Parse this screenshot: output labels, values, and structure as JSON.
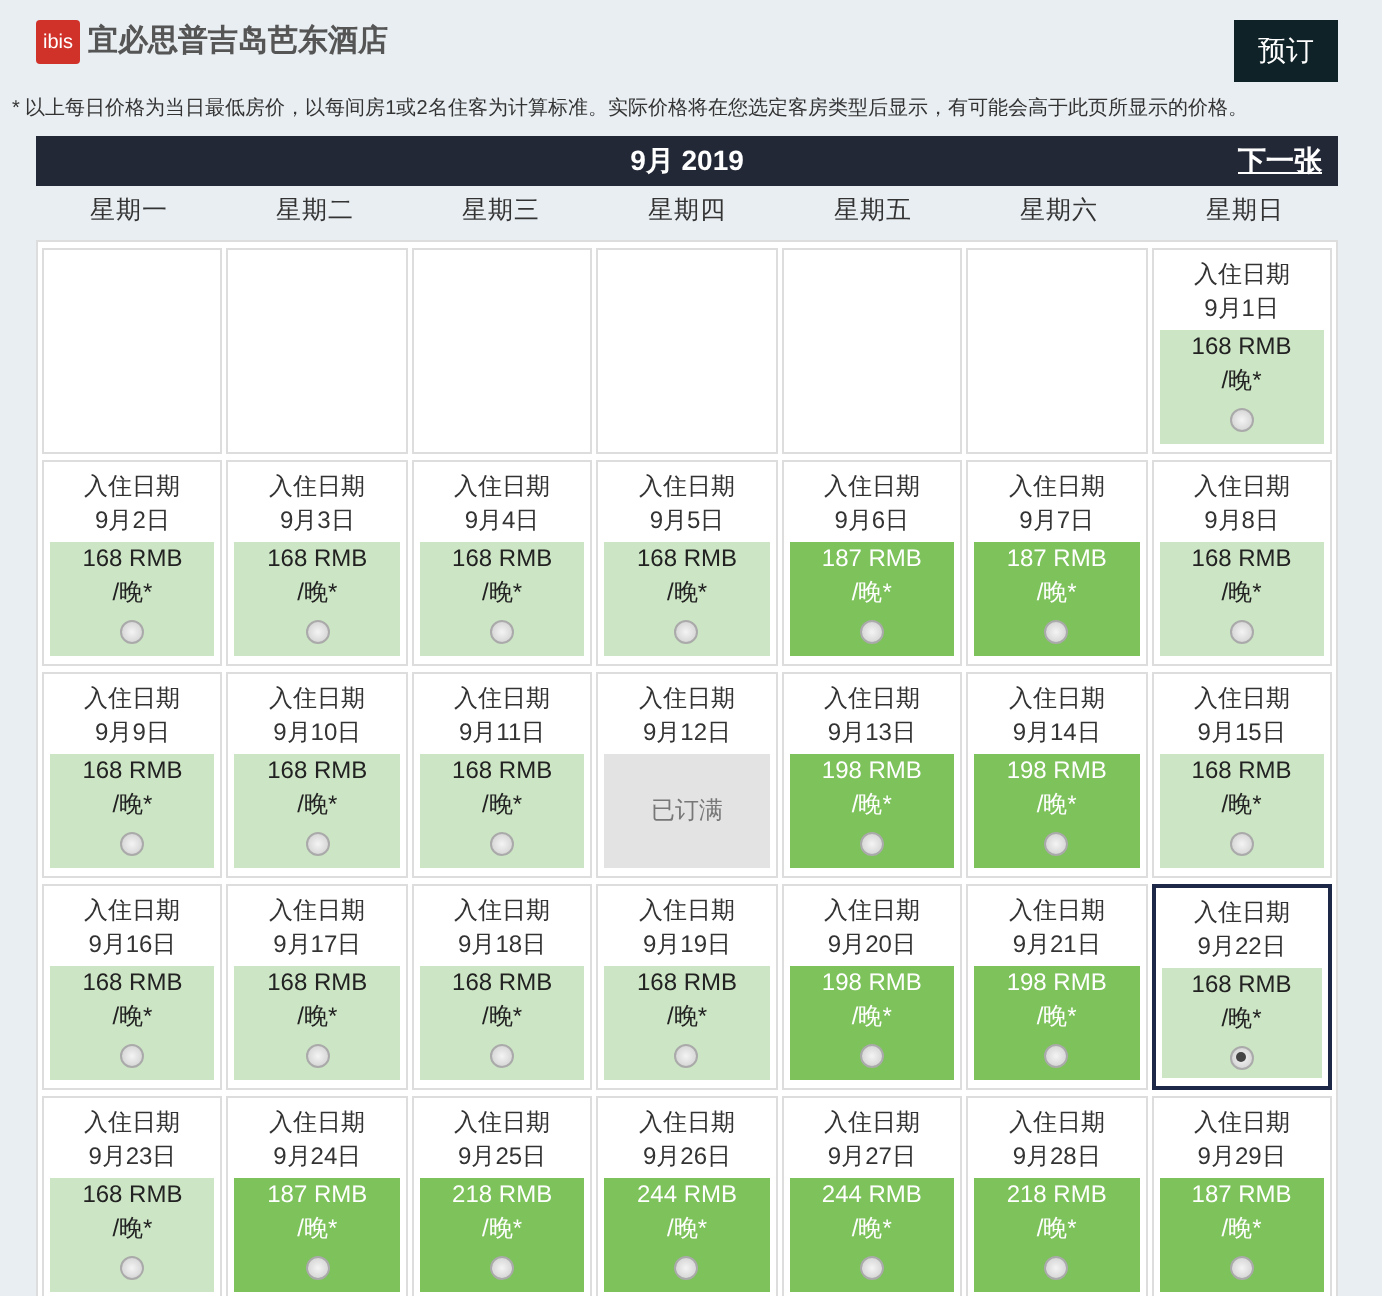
{
  "hotel": {
    "logo": "ibis",
    "name": "宜必思普吉岛芭东酒店"
  },
  "book_button": "预订",
  "note": "* 以上每日价格为当日最低房价，以每间房1或2名住客为计算标准。实际价格将在您选定客房类型后显示，有可能会高于此页所显示的价格。",
  "calendar": {
    "month": "9月 2019",
    "next": "下一张",
    "weekdays": [
      "星期一",
      "星期二",
      "星期三",
      "星期四",
      "星期五",
      "星期六",
      "星期日"
    ],
    "weeks": [
      [
        {
          "kind": "empty"
        },
        {
          "kind": "empty"
        },
        {
          "kind": "empty"
        },
        {
          "kind": "empty"
        },
        {
          "kind": "empty"
        },
        {
          "kind": "empty"
        },
        {
          "kind": "open",
          "label": "入住日期",
          "date": "9月1日",
          "price": "168 RMB",
          "per": "/晚*",
          "color": "#cce5c4",
          "selected": false
        }
      ],
      [
        {
          "kind": "open",
          "label": "入住日期",
          "date": "9月2日",
          "price": "168 RMB",
          "per": "/晚*",
          "color": "#cce5c4",
          "selected": false
        },
        {
          "kind": "open",
          "label": "入住日期",
          "date": "9月3日",
          "price": "168 RMB",
          "per": "/晚*",
          "color": "#cce5c4",
          "selected": false
        },
        {
          "kind": "open",
          "label": "入住日期",
          "date": "9月4日",
          "price": "168 RMB",
          "per": "/晚*",
          "color": "#cce5c4",
          "selected": false
        },
        {
          "kind": "open",
          "label": "入住日期",
          "date": "9月5日",
          "price": "168 RMB",
          "per": "/晚*",
          "color": "#cce5c4",
          "selected": false
        },
        {
          "kind": "open",
          "label": "入住日期",
          "date": "9月6日",
          "price": "187 RMB",
          "per": "/晚*",
          "color": "#7dc25b",
          "selected": false
        },
        {
          "kind": "open",
          "label": "入住日期",
          "date": "9月7日",
          "price": "187 RMB",
          "per": "/晚*",
          "color": "#7dc25b",
          "selected": false
        },
        {
          "kind": "open",
          "label": "入住日期",
          "date": "9月8日",
          "price": "168 RMB",
          "per": "/晚*",
          "color": "#cce5c4",
          "selected": false
        }
      ],
      [
        {
          "kind": "open",
          "label": "入住日期",
          "date": "9月9日",
          "price": "168 RMB",
          "per": "/晚*",
          "color": "#cce5c4",
          "selected": false
        },
        {
          "kind": "open",
          "label": "入住日期",
          "date": "9月10日",
          "price": "168 RMB",
          "per": "/晚*",
          "color": "#cce5c4",
          "selected": false
        },
        {
          "kind": "open",
          "label": "入住日期",
          "date": "9月11日",
          "price": "168 RMB",
          "per": "/晚*",
          "color": "#cce5c4",
          "selected": false
        },
        {
          "kind": "full",
          "label": "入住日期",
          "date": "9月12日",
          "status": "已订满"
        },
        {
          "kind": "open",
          "label": "入住日期",
          "date": "9月13日",
          "price": "198 RMB",
          "per": "/晚*",
          "color": "#7dc25b",
          "selected": false
        },
        {
          "kind": "open",
          "label": "入住日期",
          "date": "9月14日",
          "price": "198 RMB",
          "per": "/晚*",
          "color": "#7dc25b",
          "selected": false
        },
        {
          "kind": "open",
          "label": "入住日期",
          "date": "9月15日",
          "price": "168 RMB",
          "per": "/晚*",
          "color": "#cce5c4",
          "selected": false
        }
      ],
      [
        {
          "kind": "open",
          "label": "入住日期",
          "date": "9月16日",
          "price": "168 RMB",
          "per": "/晚*",
          "color": "#cce5c4",
          "selected": false
        },
        {
          "kind": "open",
          "label": "入住日期",
          "date": "9月17日",
          "price": "168 RMB",
          "per": "/晚*",
          "color": "#cce5c4",
          "selected": false
        },
        {
          "kind": "open",
          "label": "入住日期",
          "date": "9月18日",
          "price": "168 RMB",
          "per": "/晚*",
          "color": "#cce5c4",
          "selected": false
        },
        {
          "kind": "open",
          "label": "入住日期",
          "date": "9月19日",
          "price": "168 RMB",
          "per": "/晚*",
          "color": "#cce5c4",
          "selected": false
        },
        {
          "kind": "open",
          "label": "入住日期",
          "date": "9月20日",
          "price": "198 RMB",
          "per": "/晚*",
          "color": "#7dc25b",
          "selected": false
        },
        {
          "kind": "open",
          "label": "入住日期",
          "date": "9月21日",
          "price": "198 RMB",
          "per": "/晚*",
          "color": "#7dc25b",
          "selected": false
        },
        {
          "kind": "open",
          "label": "入住日期",
          "date": "9月22日",
          "price": "168 RMB",
          "per": "/晚*",
          "color": "#cce5c4",
          "selected": true
        }
      ],
      [
        {
          "kind": "open",
          "label": "入住日期",
          "date": "9月23日",
          "price": "168 RMB",
          "per": "/晚*",
          "color": "#cce5c4",
          "selected": false
        },
        {
          "kind": "open",
          "label": "入住日期",
          "date": "9月24日",
          "price": "187 RMB",
          "per": "/晚*",
          "color": "#7dc25b",
          "selected": false
        },
        {
          "kind": "open",
          "label": "入住日期",
          "date": "9月25日",
          "price": "218 RMB",
          "per": "/晚*",
          "color": "#7dc25b",
          "selected": false
        },
        {
          "kind": "open",
          "label": "入住日期",
          "date": "9月26日",
          "price": "244 RMB",
          "per": "/晚*",
          "color": "#7dc25b",
          "selected": false
        },
        {
          "kind": "open",
          "label": "入住日期",
          "date": "9月27日",
          "price": "244 RMB",
          "per": "/晚*",
          "color": "#7dc25b",
          "selected": false
        },
        {
          "kind": "open",
          "label": "入住日期",
          "date": "9月28日",
          "price": "218 RMB",
          "per": "/晚*",
          "color": "#7dc25b",
          "selected": false
        },
        {
          "kind": "open",
          "label": "入住日期",
          "date": "9月29日",
          "price": "187 RMB",
          "per": "/晚*",
          "color": "#7dc25b",
          "selected": false
        }
      ]
    ]
  }
}
